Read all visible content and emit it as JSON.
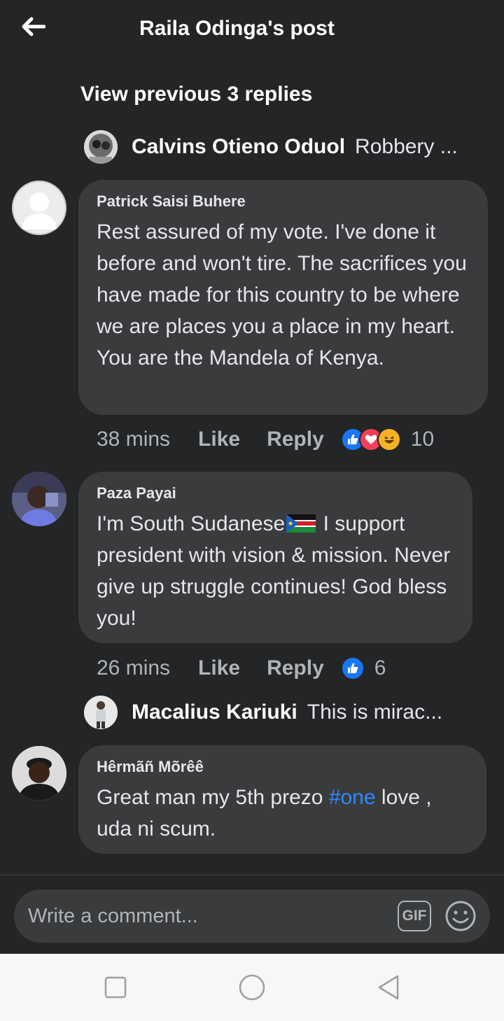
{
  "header": {
    "title": "Raila Odinga's post"
  },
  "view_previous": "View previous 3 replies",
  "reply_previews": [
    {
      "name": "Calvins Otieno Oduol",
      "text": "Robbery ..."
    },
    {
      "name": "Macalius Kariuki",
      "text": "This is mirac..."
    }
  ],
  "comments": [
    {
      "author": "Patrick Saisi Buhere",
      "text": "Rest assured of my vote. I've done it before and won't tire. The sacrifices you have made for this country to be where we are places you a place in my heart. You are the Mandela of Kenya.",
      "time": "38 mins",
      "like": "Like",
      "reply": "Reply",
      "reactions": [
        "like",
        "love",
        "haha"
      ],
      "reaction_count": "10"
    },
    {
      "author": "Paza Payai",
      "text_before_flag": "I'm South Sudanese",
      "text_after_flag": " I support president with vision & mission. Never give up struggle continues! God bless you!",
      "time": "26 mins",
      "like": "Like",
      "reply": "Reply",
      "reactions": [
        "like"
      ],
      "reaction_count": "6"
    },
    {
      "author": "Hêrmãñ Mõrêê",
      "text_before_tag": "Great man my 5th prezo ",
      "hashtag": "#one",
      "text_after_tag": " love , uda ni scum."
    }
  ],
  "composer": {
    "placeholder": "Write a comment...",
    "gif_label": "GIF"
  },
  "colors": {
    "background": "#242526",
    "bubble": "#3a3b3c",
    "link": "#2d88ff",
    "muted": "#b0b3b8",
    "like": "#1877f2",
    "love": "#f33e58",
    "haha": "#f7b125"
  },
  "icons": [
    "back-arrow-icon",
    "gif-icon",
    "emoji-icon",
    "nav-square-icon",
    "nav-circle-icon",
    "nav-back-triangle-icon"
  ]
}
